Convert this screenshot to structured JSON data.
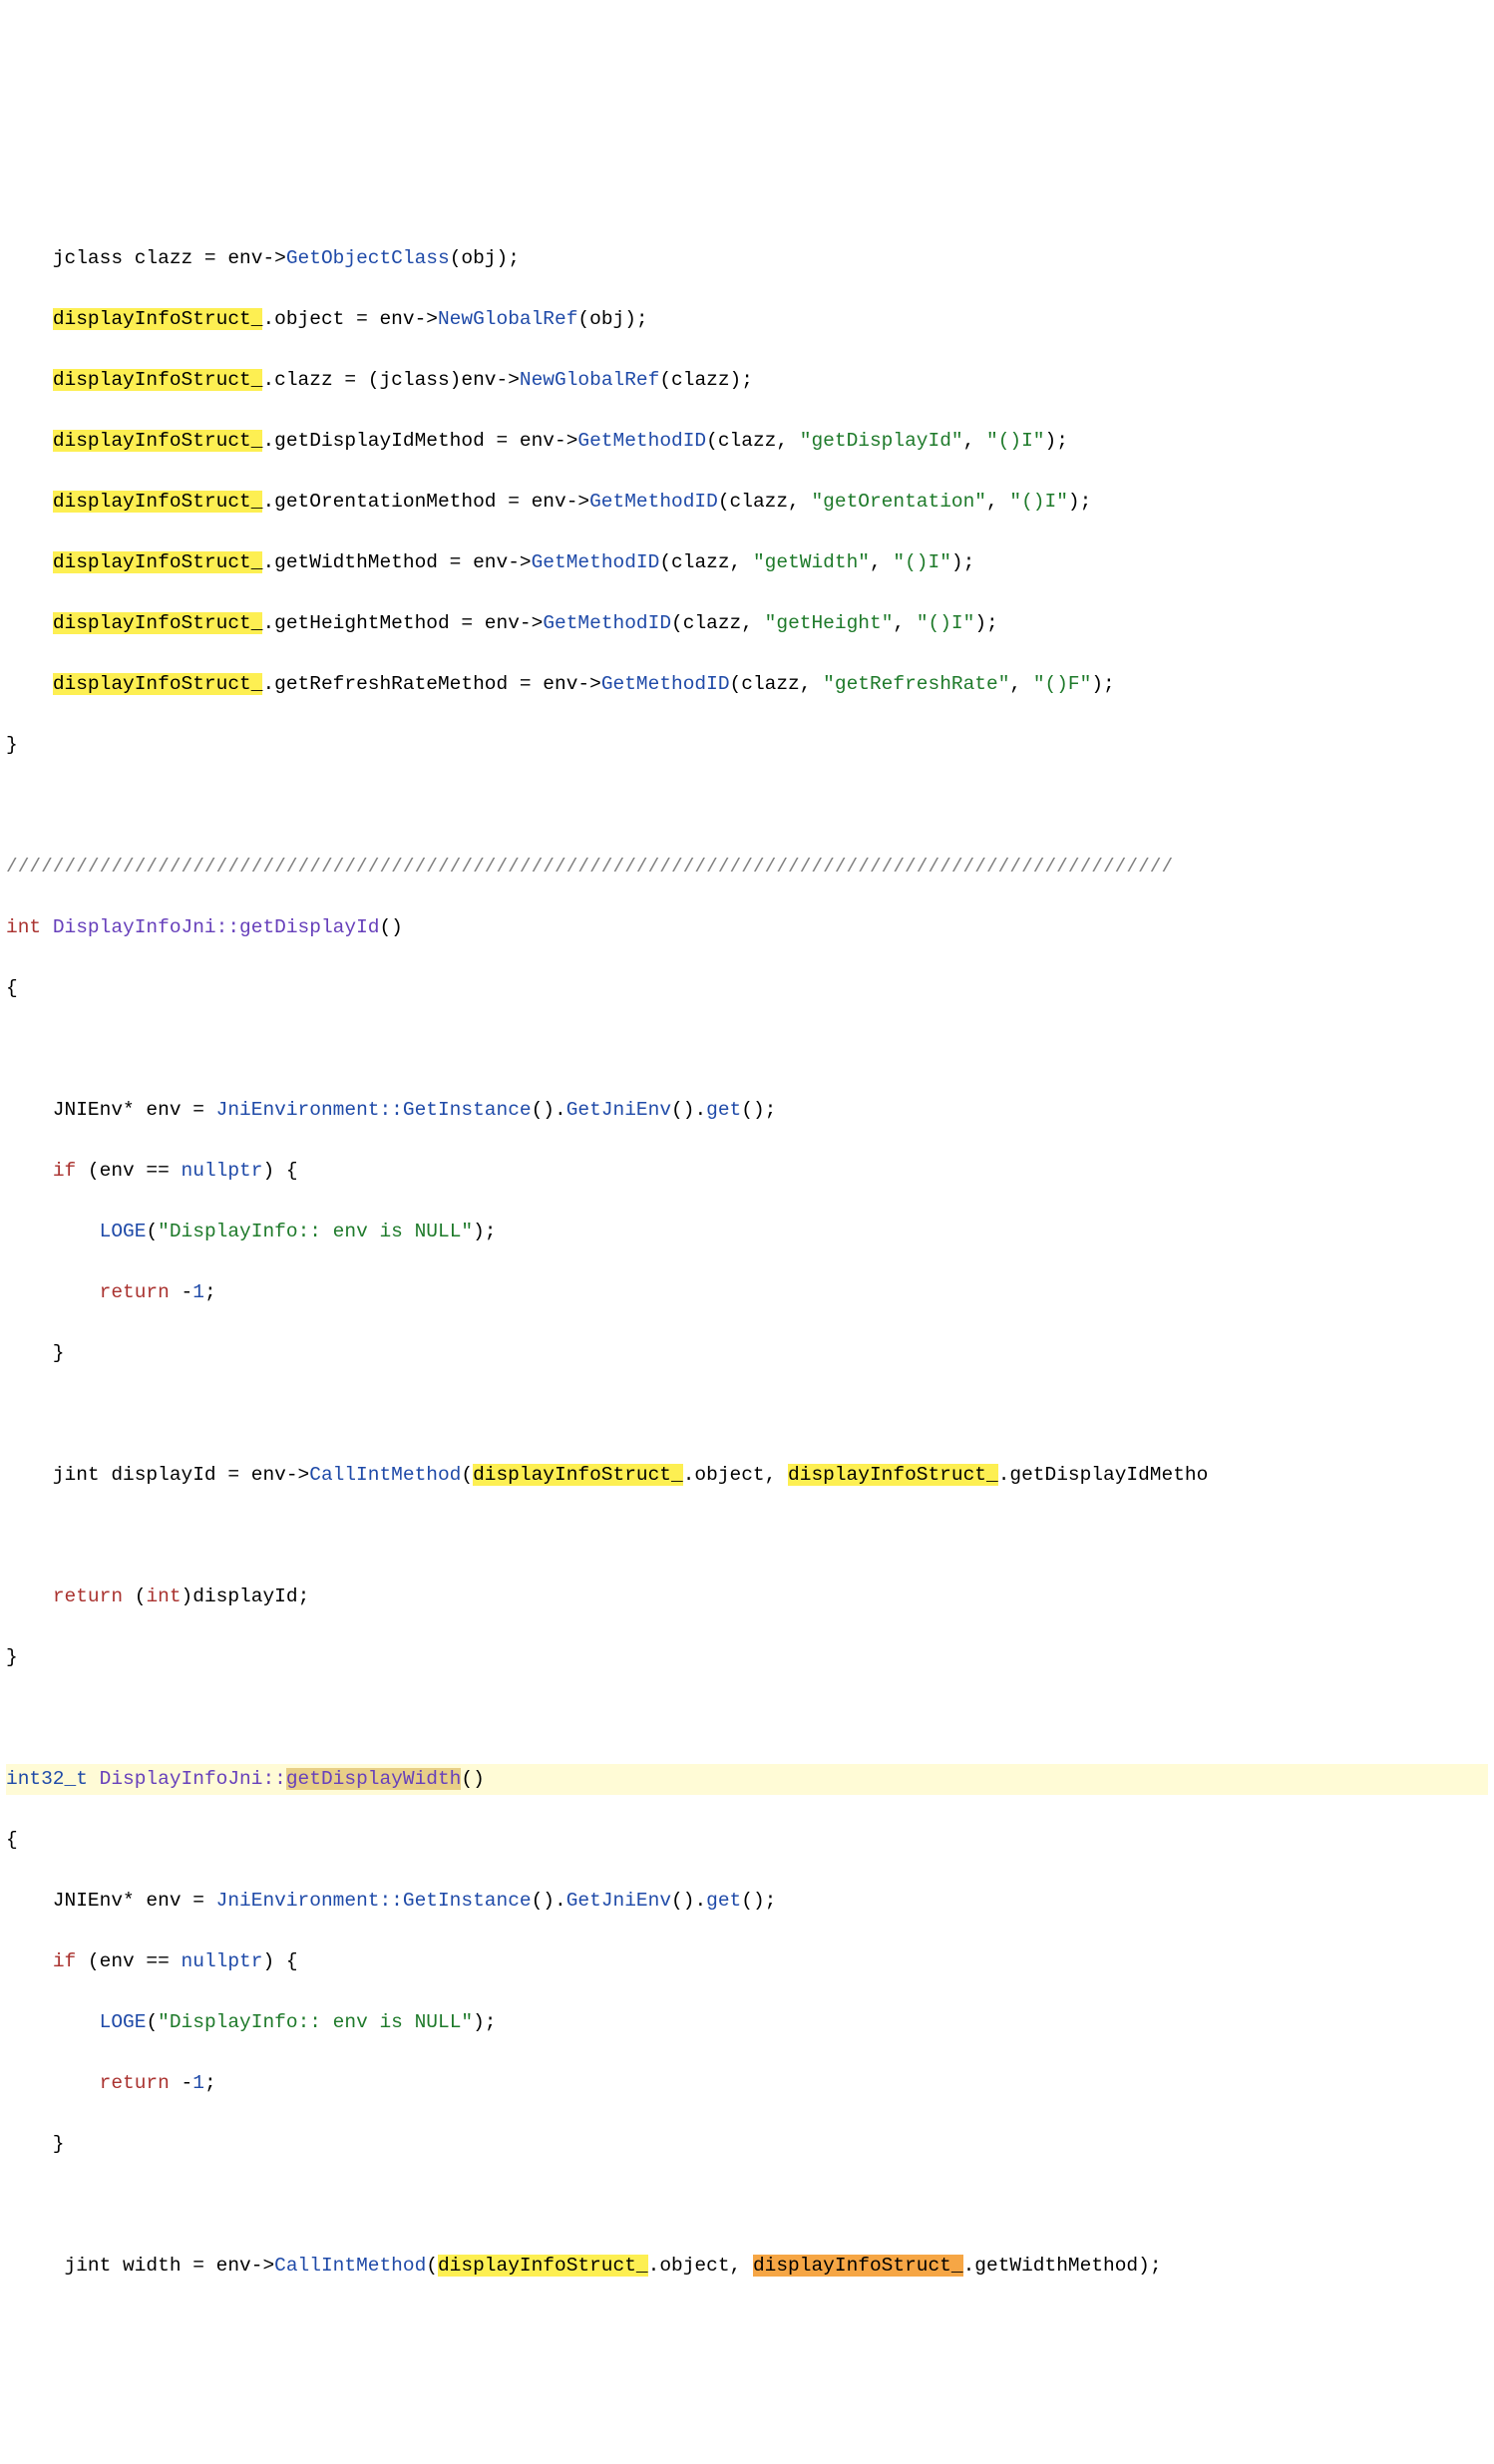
{
  "tokens": {
    "dis": "displayInfoStruct_",
    "GetObjectClass": "GetObjectClass",
    "NewGlobalRef": "NewGlobalRef",
    "GetMethodID": "GetMethodID",
    "JniEnvironment": "JniEnvironment",
    "GetInstance": "GetInstance",
    "GetJniEnv": "GetJniEnv",
    "get": "get",
    "CallIntMethod": "CallIntMethod",
    "DisplayInfoJni": "DisplayInfoJni",
    "getDisplayId": "getDisplayId",
    "getDisplayWidth": "getDisplayWidth",
    "nullptr": "nullptr",
    "int": "int",
    "int32_t": "int32_t",
    "if": "if",
    "return": "return",
    "LOGE": "LOGE"
  },
  "strings": {
    "getDisplayId": "\"getDisplayId\"",
    "getOrentation": "\"getOrentation\"",
    "getWidth": "\"getWidth\"",
    "getHeight": "\"getHeight\"",
    "getRefreshRate": "\"getRefreshRate\"",
    "sigI": "\"()I\"",
    "sigF": "\"()F\"",
    "envNull": "\"DisplayInfo:: env is NULL\""
  },
  "plain": {
    "l1a": "    jclass clazz = env->",
    "l1b": "(obj);",
    "l2a": ".object = env->",
    "l2b": "(obj);",
    "l3a": ".clazz = (jclass)env->",
    "l3b": "(clazz);",
    "l4a": ".getDisplayIdMethod = env->",
    "l5a": ".getOrentationMethod = env->",
    "l6a": ".getWidthMethod = env->",
    "l7a": ".getHeightMethod = env->",
    "l8a": ".getRefreshRateMethod = env->",
    "gm_open": "(clazz, ",
    "gm_sep": ", ",
    "gm_close": ");",
    "brace_close": "}",
    "brace_open": "{",
    "slashes": "////////////////////////////////////////////////////////////////////////////////////////////////////",
    "fn1_sig_a": " ",
    "scope": "::",
    "paren": "()",
    "envLine_a": "    JNIEnv* env = ",
    "envLine_b": "().",
    "envLine_c": "().",
    "envLine_d": "();",
    "ifLine_a": " (env == ",
    "ifLine_b": ") {",
    "loge_a": "(",
    "loge_b": ");",
    "ret_a": " -",
    "ret_b": ";",
    "closeB": "    }",
    "displayIdLine_a": "    jint displayId = env->",
    "displayIdLine_b": "(",
    "displayIdLine_c": ".object, ",
    "displayIdLine_d": ".getDisplayIdMetho",
    "retDisp_a": " (",
    "retDisp_b": ")displayId;",
    "widthLine_a": "     jint width = env->",
    "widthLine_d": ".getWidthMethod);",
    "one": "1",
    "sp4": "    ",
    "sp8": "        "
  }
}
